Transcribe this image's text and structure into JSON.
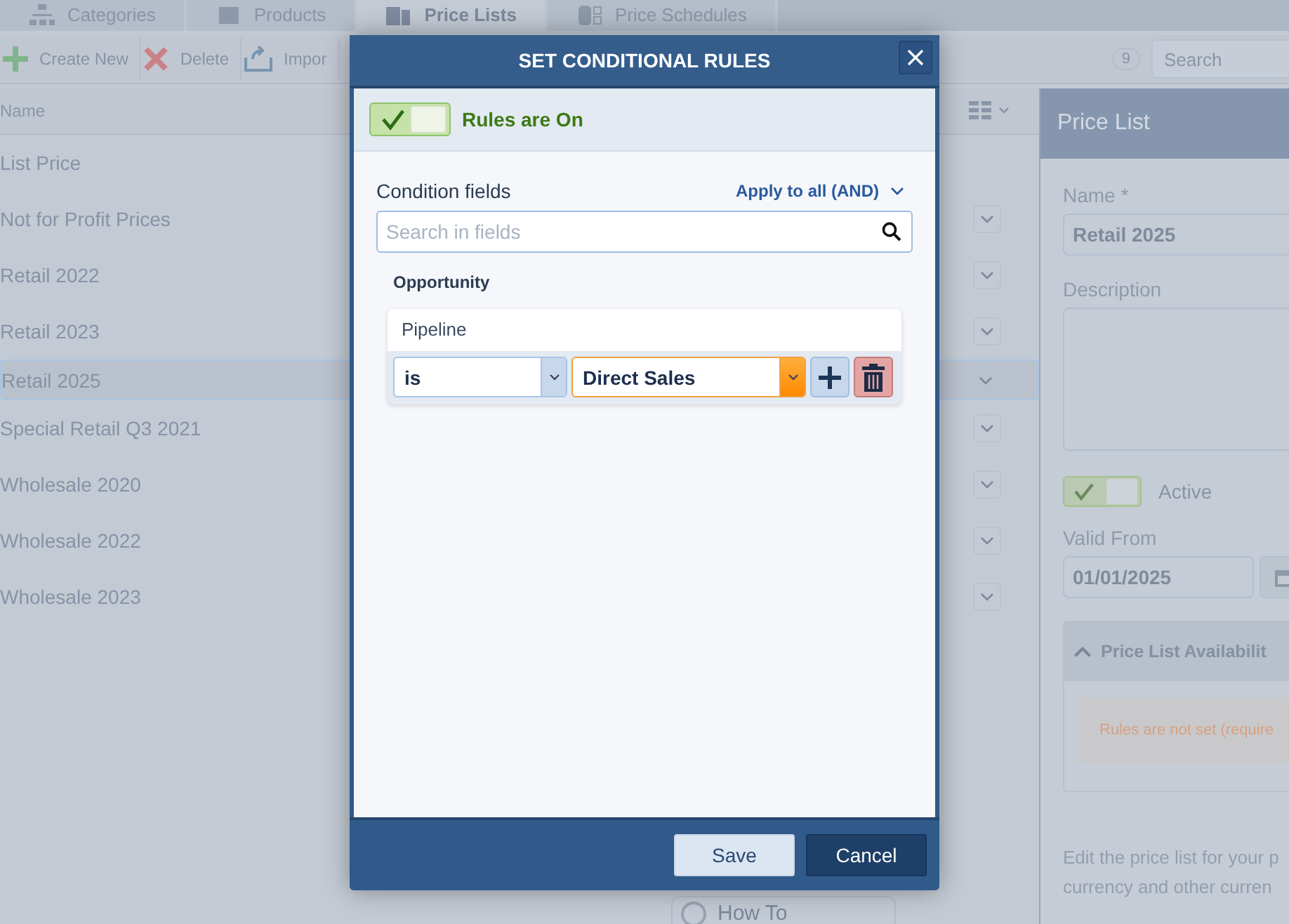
{
  "tabs": [
    {
      "label": "Categories",
      "selected": false
    },
    {
      "label": "Products",
      "selected": false
    },
    {
      "label": "Price Lists",
      "selected": true
    },
    {
      "label": "Price Schedules",
      "selected": false
    }
  ],
  "toolbar": {
    "buttons": [
      {
        "label": "Create New",
        "kind": "add"
      },
      {
        "label": "Delete",
        "kind": "delete"
      },
      {
        "label": "Impor",
        "kind": "import"
      }
    ],
    "count": "9",
    "search_placeholder": "Search"
  },
  "list": {
    "column": "Name",
    "rows": [
      {
        "name": "List Price",
        "selected": false,
        "menu": false
      },
      {
        "name": "Not for Profit Prices",
        "selected": false,
        "menu": true
      },
      {
        "name": "Retail 2022",
        "selected": false,
        "menu": true
      },
      {
        "name": "Retail 2023",
        "selected": false,
        "menu": true
      },
      {
        "name": "Retail 2025",
        "selected": true,
        "menu": true
      },
      {
        "name": "Special Retail Q3 2021",
        "selected": false,
        "menu": true
      },
      {
        "name": "Wholesale 2020",
        "selected": false,
        "menu": true
      },
      {
        "name": "Wholesale 2022",
        "selected": false,
        "menu": true
      },
      {
        "name": "Wholesale 2023",
        "selected": false,
        "menu": true
      }
    ]
  },
  "details": {
    "title": "Price List",
    "name_label": "Name *",
    "name_value": "Retail 2025",
    "description_label": "Description",
    "active": {
      "label": "Active",
      "on": true
    },
    "valid_from_label": "Valid From",
    "valid_from": "01/01/2025",
    "availability": {
      "title": "Price List Availabilit",
      "expanded": true,
      "warning": "Rules are not set (require"
    },
    "help": [
      "Edit the price list for your p",
      "currency and other curren"
    ]
  },
  "how_to": "How To",
  "dialog": {
    "title": "SET CONDITIONAL RULES",
    "rules_toggle": {
      "label": "Rules are On",
      "on": true
    },
    "fields_label": "Condition fields",
    "apply_mode": "Apply to all (AND)",
    "search_placeholder": "Search in fields",
    "groups": [
      {
        "name": "Opportunity",
        "conditions": [
          {
            "field": "Pipeline",
            "operator": "is",
            "value": "Direct Sales"
          }
        ]
      }
    ],
    "buttons": [
      {
        "label": "Save",
        "kind": "primary"
      },
      {
        "label": "Cancel",
        "kind": "secondary"
      }
    ]
  }
}
